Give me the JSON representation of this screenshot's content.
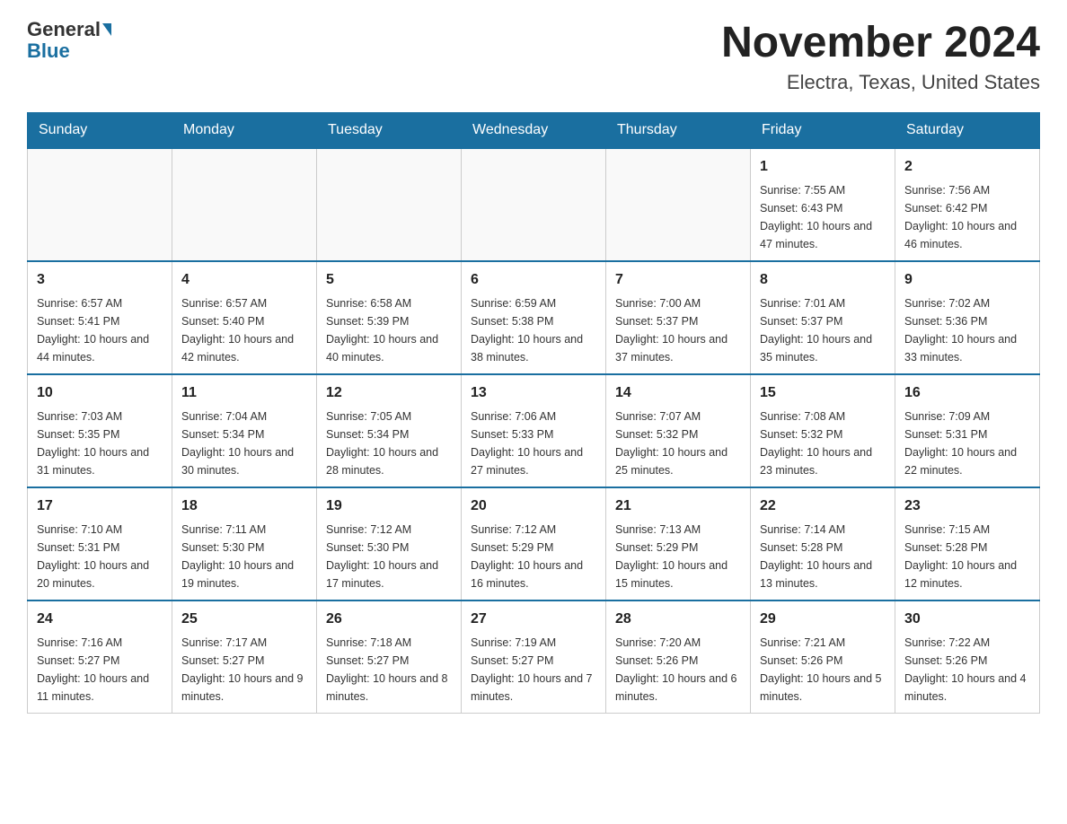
{
  "header": {
    "logo_general": "General",
    "logo_blue": "Blue",
    "month_title": "November 2024",
    "location": "Electra, Texas, United States"
  },
  "days_of_week": [
    "Sunday",
    "Monday",
    "Tuesday",
    "Wednesday",
    "Thursday",
    "Friday",
    "Saturday"
  ],
  "weeks": [
    [
      {
        "day": "",
        "info": ""
      },
      {
        "day": "",
        "info": ""
      },
      {
        "day": "",
        "info": ""
      },
      {
        "day": "",
        "info": ""
      },
      {
        "day": "",
        "info": ""
      },
      {
        "day": "1",
        "info": "Sunrise: 7:55 AM\nSunset: 6:43 PM\nDaylight: 10 hours and 47 minutes."
      },
      {
        "day": "2",
        "info": "Sunrise: 7:56 AM\nSunset: 6:42 PM\nDaylight: 10 hours and 46 minutes."
      }
    ],
    [
      {
        "day": "3",
        "info": "Sunrise: 6:57 AM\nSunset: 5:41 PM\nDaylight: 10 hours and 44 minutes."
      },
      {
        "day": "4",
        "info": "Sunrise: 6:57 AM\nSunset: 5:40 PM\nDaylight: 10 hours and 42 minutes."
      },
      {
        "day": "5",
        "info": "Sunrise: 6:58 AM\nSunset: 5:39 PM\nDaylight: 10 hours and 40 minutes."
      },
      {
        "day": "6",
        "info": "Sunrise: 6:59 AM\nSunset: 5:38 PM\nDaylight: 10 hours and 38 minutes."
      },
      {
        "day": "7",
        "info": "Sunrise: 7:00 AM\nSunset: 5:37 PM\nDaylight: 10 hours and 37 minutes."
      },
      {
        "day": "8",
        "info": "Sunrise: 7:01 AM\nSunset: 5:37 PM\nDaylight: 10 hours and 35 minutes."
      },
      {
        "day": "9",
        "info": "Sunrise: 7:02 AM\nSunset: 5:36 PM\nDaylight: 10 hours and 33 minutes."
      }
    ],
    [
      {
        "day": "10",
        "info": "Sunrise: 7:03 AM\nSunset: 5:35 PM\nDaylight: 10 hours and 31 minutes."
      },
      {
        "day": "11",
        "info": "Sunrise: 7:04 AM\nSunset: 5:34 PM\nDaylight: 10 hours and 30 minutes."
      },
      {
        "day": "12",
        "info": "Sunrise: 7:05 AM\nSunset: 5:34 PM\nDaylight: 10 hours and 28 minutes."
      },
      {
        "day": "13",
        "info": "Sunrise: 7:06 AM\nSunset: 5:33 PM\nDaylight: 10 hours and 27 minutes."
      },
      {
        "day": "14",
        "info": "Sunrise: 7:07 AM\nSunset: 5:32 PM\nDaylight: 10 hours and 25 minutes."
      },
      {
        "day": "15",
        "info": "Sunrise: 7:08 AM\nSunset: 5:32 PM\nDaylight: 10 hours and 23 minutes."
      },
      {
        "day": "16",
        "info": "Sunrise: 7:09 AM\nSunset: 5:31 PM\nDaylight: 10 hours and 22 minutes."
      }
    ],
    [
      {
        "day": "17",
        "info": "Sunrise: 7:10 AM\nSunset: 5:31 PM\nDaylight: 10 hours and 20 minutes."
      },
      {
        "day": "18",
        "info": "Sunrise: 7:11 AM\nSunset: 5:30 PM\nDaylight: 10 hours and 19 minutes."
      },
      {
        "day": "19",
        "info": "Sunrise: 7:12 AM\nSunset: 5:30 PM\nDaylight: 10 hours and 17 minutes."
      },
      {
        "day": "20",
        "info": "Sunrise: 7:12 AM\nSunset: 5:29 PM\nDaylight: 10 hours and 16 minutes."
      },
      {
        "day": "21",
        "info": "Sunrise: 7:13 AM\nSunset: 5:29 PM\nDaylight: 10 hours and 15 minutes."
      },
      {
        "day": "22",
        "info": "Sunrise: 7:14 AM\nSunset: 5:28 PM\nDaylight: 10 hours and 13 minutes."
      },
      {
        "day": "23",
        "info": "Sunrise: 7:15 AM\nSunset: 5:28 PM\nDaylight: 10 hours and 12 minutes."
      }
    ],
    [
      {
        "day": "24",
        "info": "Sunrise: 7:16 AM\nSunset: 5:27 PM\nDaylight: 10 hours and 11 minutes."
      },
      {
        "day": "25",
        "info": "Sunrise: 7:17 AM\nSunset: 5:27 PM\nDaylight: 10 hours and 9 minutes."
      },
      {
        "day": "26",
        "info": "Sunrise: 7:18 AM\nSunset: 5:27 PM\nDaylight: 10 hours and 8 minutes."
      },
      {
        "day": "27",
        "info": "Sunrise: 7:19 AM\nSunset: 5:27 PM\nDaylight: 10 hours and 7 minutes."
      },
      {
        "day": "28",
        "info": "Sunrise: 7:20 AM\nSunset: 5:26 PM\nDaylight: 10 hours and 6 minutes."
      },
      {
        "day": "29",
        "info": "Sunrise: 7:21 AM\nSunset: 5:26 PM\nDaylight: 10 hours and 5 minutes."
      },
      {
        "day": "30",
        "info": "Sunrise: 7:22 AM\nSunset: 5:26 PM\nDaylight: 10 hours and 4 minutes."
      }
    ]
  ]
}
